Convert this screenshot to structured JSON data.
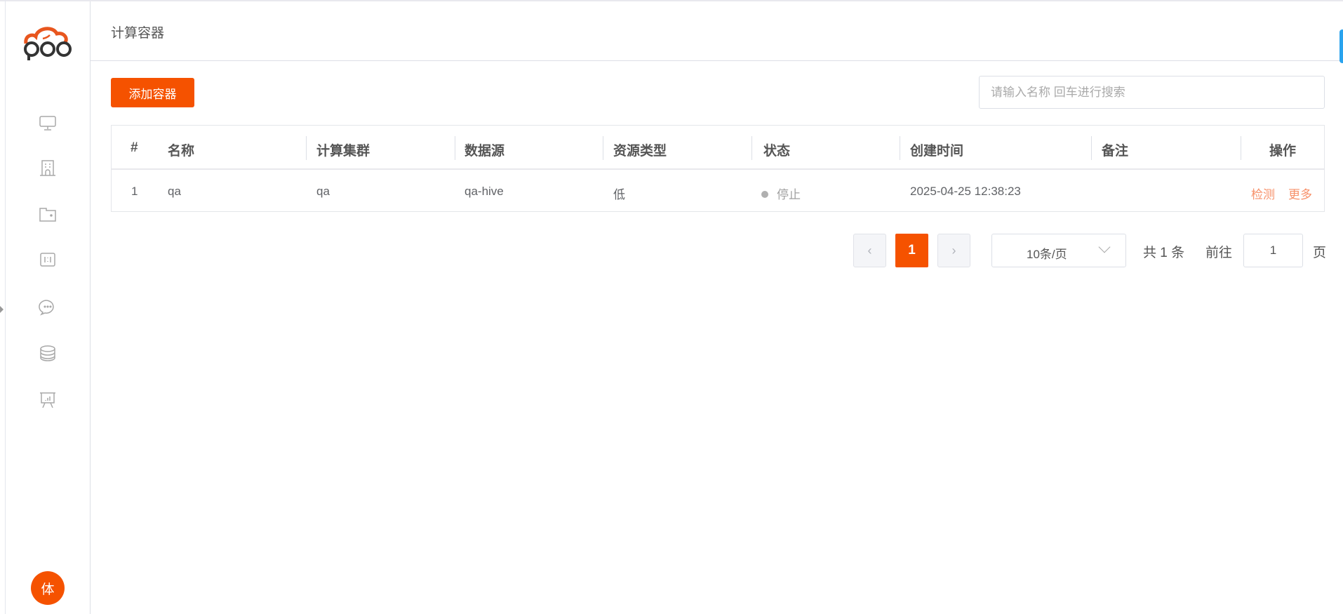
{
  "header": {
    "title": "计算容器"
  },
  "sidebar": {
    "icons": [
      "monitor-icon",
      "building-icon",
      "folder-icon",
      "panel-icon",
      "chat-icon",
      "database-icon",
      "presentation-icon"
    ],
    "avatar_text": "体"
  },
  "toolbar": {
    "add_label": "添加容器",
    "search_placeholder": "请输入名称 回车进行搜索",
    "search_value": ""
  },
  "table": {
    "columns": [
      "#",
      "名称",
      "计算集群",
      "数据源",
      "资源类型",
      "状态",
      "创建时间",
      "备注",
      "操作"
    ],
    "rows": [
      {
        "index": "1",
        "name": "qa",
        "cluster": "qa",
        "datasource": "qa-hive",
        "resource_type": "低",
        "status": "停止",
        "created": "2025-04-25 12:38:23",
        "remark": "",
        "actions": [
          "检测",
          "更多"
        ]
      }
    ]
  },
  "pagination": {
    "current": "1",
    "page_size": "10条/页",
    "total": "共 1 条",
    "goto_label": "前往",
    "goto_value": "1",
    "page_suffix": "页",
    "prev": "‹",
    "next": "›"
  },
  "colors": {
    "brand": "#f55200",
    "link": "#f7916a"
  }
}
